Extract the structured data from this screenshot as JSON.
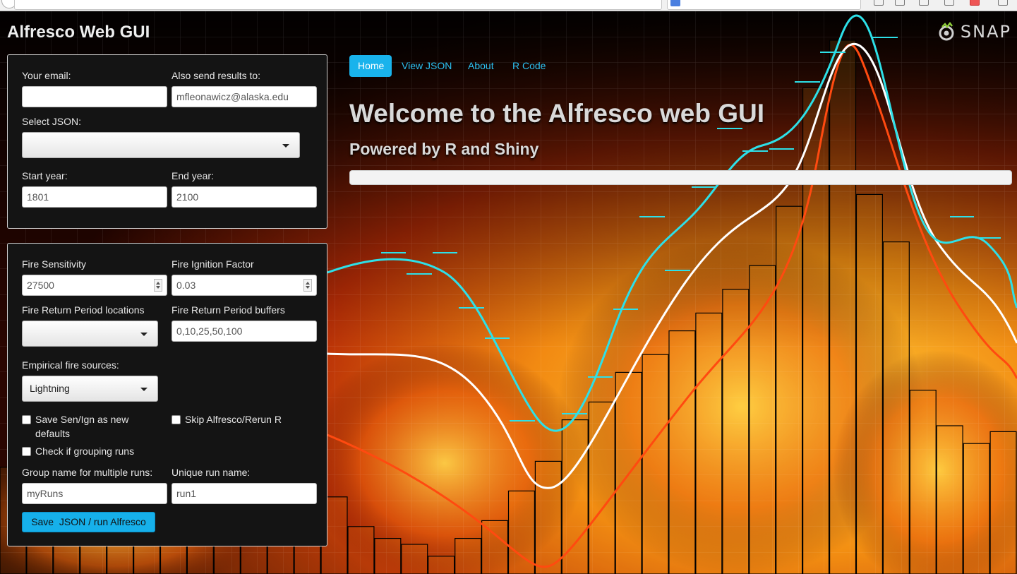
{
  "app": {
    "title": "Alfresco Web GUI",
    "logo_text": "SNAP"
  },
  "nav": {
    "tabs": [
      {
        "label": "Home",
        "active": true
      },
      {
        "label": "View JSON",
        "active": false
      },
      {
        "label": "About",
        "active": false
      },
      {
        "label": "R Code",
        "active": false
      }
    ]
  },
  "main": {
    "heading": "Welcome to the Alfresco web GUI",
    "subheading": "Powered by R and Shiny",
    "progress": 0
  },
  "settings": {
    "email_label": "Your email:",
    "email_value": "",
    "cc_label": "Also send results to:",
    "cc_value": "mfleonawicz@alaska.edu",
    "json_label": "Select JSON:",
    "json_value": "",
    "start_label": "Start year:",
    "start_value": "1801",
    "end_label": "End year:",
    "end_value": "2100"
  },
  "fire": {
    "sensitivity_label": "Fire Sensitivity",
    "sensitivity_value": "27500",
    "ignition_label": "Fire Ignition Factor",
    "ignition_value": "0.03",
    "frp_locations_label": "Fire Return Period locations",
    "frp_locations_value": "",
    "frp_buffers_label": "Fire Return Period buffers",
    "frp_buffers_value": "0,10,25,50,100",
    "empirical_label": "Empirical fire sources:",
    "empirical_value": "Lightning",
    "save_defaults_label": "Save Sen/Ign as new defaults",
    "skip_label": "Skip Alfresco/Rerun R",
    "grouping_label": "Check if grouping runs",
    "group_name_label": "Group name for multiple runs:",
    "group_name_value": "myRuns",
    "run_name_label": "Unique run name:",
    "run_name_value": "run1",
    "run_button_label": "Save  JSON / run Alfresco"
  },
  "colors": {
    "accent": "#19b3ec",
    "panel": "#141414",
    "curve_cyan": "#2de0e8",
    "curve_white": "#ffffff",
    "curve_orange": "#ff4a10"
  },
  "background_bars": [
    36,
    12,
    16,
    18,
    20,
    22,
    44,
    58,
    70,
    62,
    48,
    33,
    26,
    16,
    12,
    10,
    6,
    12,
    18,
    28,
    38,
    52,
    58,
    68,
    74,
    82,
    88,
    96,
    104,
    124,
    164,
    180,
    128,
    112,
    62,
    50,
    44,
    48
  ]
}
